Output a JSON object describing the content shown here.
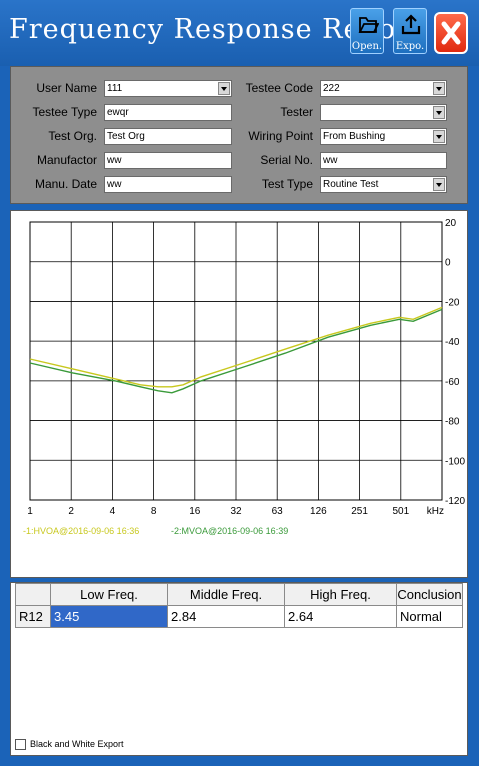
{
  "window": {
    "title": "Frequency Response Report",
    "buttons": {
      "open": "Open.",
      "export": "Expo."
    }
  },
  "form": {
    "user_name": {
      "label": "User Name",
      "value": "111"
    },
    "testee_type": {
      "label": "Testee Type",
      "value": "ewqr"
    },
    "test_org": {
      "label": "Test Org.",
      "value": "Test Org"
    },
    "manufactor": {
      "label": "Manufactor",
      "value": "ww"
    },
    "manu_date": {
      "label": "Manu. Date",
      "value": "ww"
    },
    "testee_code": {
      "label": "Testee Code",
      "value": "222"
    },
    "tester": {
      "label": "Tester",
      "value": ""
    },
    "wiring_point": {
      "label": "Wiring Point",
      "value": "From Bushing"
    },
    "serial_no": {
      "label": "Serial No.",
      "value": "ww"
    },
    "test_type": {
      "label": "Test Type",
      "value": "Routine Test"
    }
  },
  "chart_data": {
    "type": "line",
    "x_tick_labels": [
      "1",
      "2",
      "4",
      "8",
      "16",
      "32",
      "63",
      "126",
      "251",
      "501"
    ],
    "x_unit": "kHz",
    "y_tick_labels": [
      "20",
      "0",
      "-20",
      "-40",
      "-60",
      "-80",
      "-100",
      "-120"
    ],
    "ylim": [
      -120,
      20
    ],
    "x_scale": "log2",
    "grid": true,
    "legend_position": "bottom-left",
    "series": [
      {
        "name": "-1:HVOA@2016-09-06 16:36",
        "color": "#c8c81e",
        "x": [
          1,
          2,
          4,
          6,
          8,
          10,
          12,
          16,
          32,
          63,
          126,
          251,
          400,
          501,
          800
        ],
        "values": [
          -49,
          -54,
          -59,
          -62,
          -63,
          -63,
          -62,
          -58,
          -51,
          -44,
          -37,
          -31,
          -28,
          -29,
          -23
        ]
      },
      {
        "name": "-2:MVOA@2016-09-06 16:39",
        "color": "#3a9a3a",
        "x": [
          1,
          2,
          4,
          6,
          8,
          10,
          12,
          16,
          32,
          63,
          126,
          251,
          400,
          501,
          800
        ],
        "values": [
          -51,
          -56,
          -60,
          -63,
          -65,
          -66,
          -64,
          -60,
          -53,
          -46,
          -38,
          -32,
          -29,
          -30,
          -24
        ]
      }
    ]
  },
  "results": {
    "headers": [
      "",
      "Low Freq.",
      "Middle Freq.",
      "High Freq.",
      "Conclusion"
    ],
    "rows": [
      [
        "R12",
        "3.45",
        "2.84",
        "2.64",
        "Normal"
      ]
    ]
  },
  "bw_export": {
    "label": "Black and White Export",
    "checked": false
  },
  "colors": {
    "titlebar": "#1b63b8",
    "form_bg": "#8e8e8e",
    "selection": "#3068c8",
    "close": "#e02a10"
  }
}
